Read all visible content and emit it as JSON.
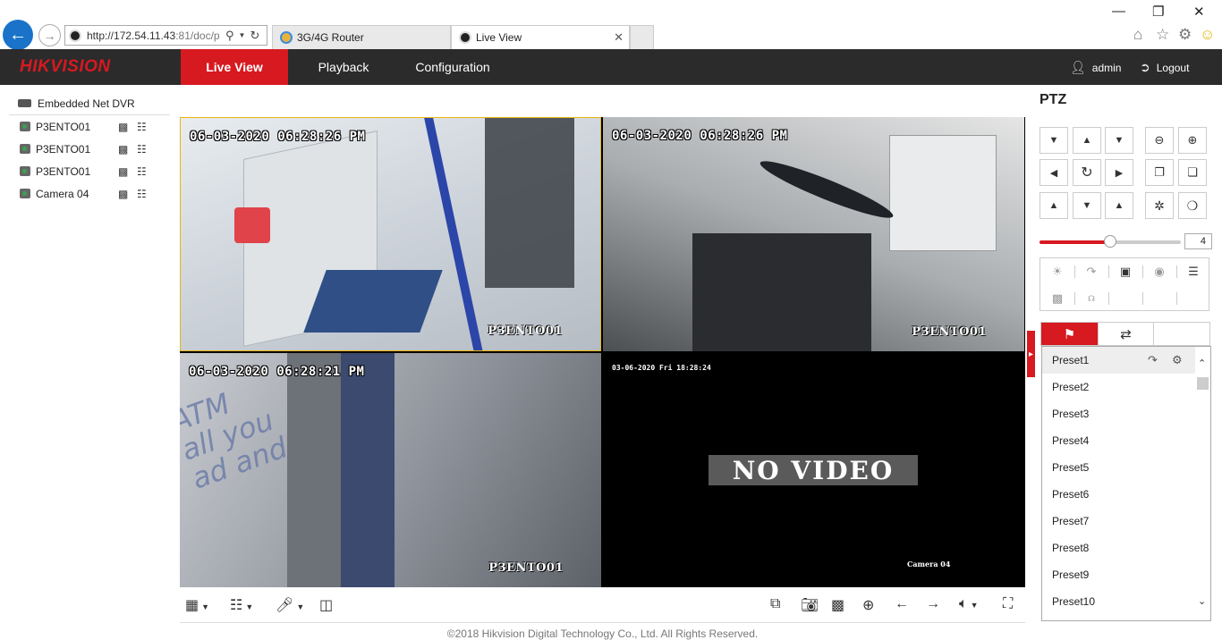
{
  "browser": {
    "url_visible": "http://172.54.11.43",
    "url_dim": ":81/doc/p",
    "tabs": [
      {
        "label": "3G/4G Router"
      },
      {
        "label": "Live View"
      }
    ]
  },
  "header": {
    "logo": "HIKVISION",
    "nav": [
      {
        "label": "Live View",
        "active": true
      },
      {
        "label": "Playback",
        "active": false
      },
      {
        "label": "Configuration",
        "active": false
      }
    ],
    "user": "admin",
    "logout": "Logout",
    "accent_color": "#d71920"
  },
  "device_tree": {
    "root": "Embedded Net DVR",
    "cameras": [
      {
        "name": "P3ENTO01"
      },
      {
        "name": "P3ENTO01"
      },
      {
        "name": "P3ENTO01"
      },
      {
        "name": "Camera 04"
      }
    ]
  },
  "video": {
    "cells": [
      {
        "timestamp": "06-03-2020 06:28:26 PM",
        "name": "P3ENTO01",
        "selected": true
      },
      {
        "timestamp": "06-03-2020 06:28:26 PM",
        "name": "P3ENTO01"
      },
      {
        "timestamp": "06-03-2020 06:28:21 PM",
        "name": "P3ENTO01"
      },
      {
        "timestamp": "03-06-2020 Fri 18:28:24",
        "name": "Camera 04",
        "status": "NO VIDEO"
      }
    ],
    "watermark_text": "ATM\nall you\nad and"
  },
  "footer": "©2018 Hikvision Digital Technology Co., Ltd. All Rights Reserved.",
  "ptz": {
    "title": "PTZ",
    "speed": 4,
    "speed_max": 7,
    "presets": [
      "Preset1",
      "Preset2",
      "Preset3",
      "Preset4",
      "Preset5",
      "Preset6",
      "Preset7",
      "Preset8",
      "Preset9",
      "Preset10"
    ]
  }
}
